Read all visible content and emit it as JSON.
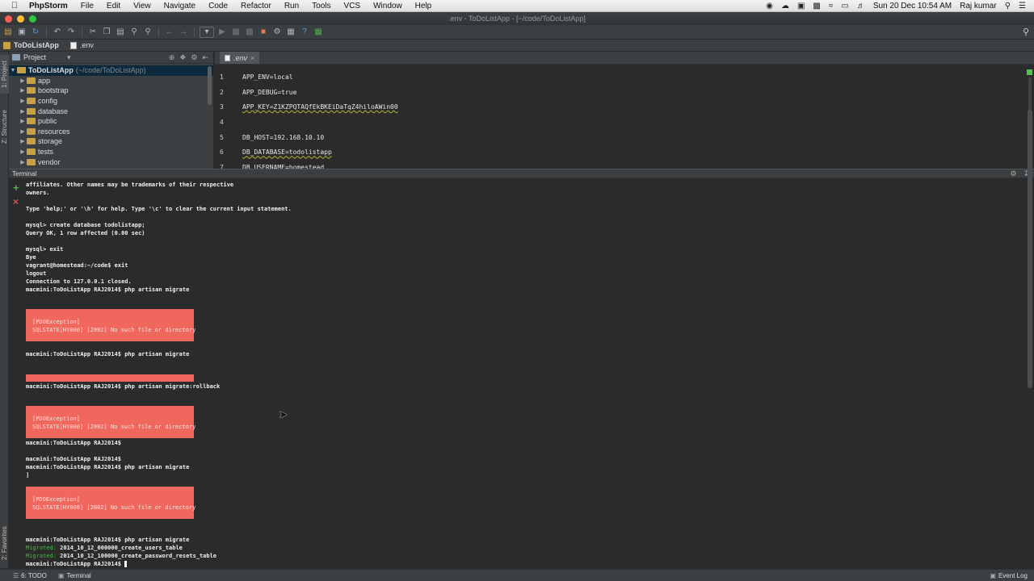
{
  "menubar": {
    "app_name": "PhpStorm",
    "items": [
      "File",
      "Edit",
      "View",
      "Navigate",
      "Code",
      "Refactor",
      "Run",
      "Tools",
      "VCS",
      "Window",
      "Help"
    ],
    "clock": "Sun 20 Dec  10:54 AM",
    "user": "Raj kumar"
  },
  "window": {
    "title": ".env - ToDoListApp - [~/code/ToDoListApp]"
  },
  "navbar": {
    "project": "ToDoListApp",
    "file": ".env"
  },
  "side_tabs": {
    "project": "1: Project",
    "structure": "Z: Structure",
    "favorites": "2: Favorites"
  },
  "project_panel": {
    "label": "Project",
    "root_name": "ToDoListApp",
    "root_path": "(~/code/ToDoListApp)",
    "folders": [
      "app",
      "bootstrap",
      "config",
      "database",
      "public",
      "resources",
      "storage",
      "tests",
      "vendor"
    ]
  },
  "editor": {
    "tab": ".env",
    "lines": [
      {
        "n": "1",
        "text": "APP_ENV=local"
      },
      {
        "n": "2",
        "text": "APP_DEBUG=true"
      },
      {
        "n": "3",
        "text": "APP_KEY=Z1KZPQTAQfEkBKEiDaTqZ4hiloAWin00"
      },
      {
        "n": "4",
        "text": ""
      },
      {
        "n": "5",
        "text": "DB_HOST=192.168.10.10"
      },
      {
        "n": "6",
        "text": "DB_DATABASE=todolistapp"
      },
      {
        "n": "7",
        "text": "DB_USERNAME=homestead"
      }
    ]
  },
  "terminal": {
    "label": "Terminal",
    "lines": {
      "l1": "affiliates. Other names may be trademarks of their respective",
      "l2": "owners.",
      "l3": "Type 'help;' or '\\h' for help. Type '\\c' to clear the current input statement.",
      "l4": "mysql> create database todolistapp;",
      "l5": "Query OK, 1 row affected (0.00 sec)",
      "l6": "mysql> exit",
      "l7": "Bye",
      "l8": "vagrant@homestead:~/code$ exit",
      "l9": "logout",
      "l10": "Connection to 127.0.0.1 closed.",
      "l11": "macmini:ToDoListApp RAJ2014$ php artisan migrate",
      "l12": "macmini:ToDoListApp RAJ2014$ php artisan migrate",
      "l13": "macmini:ToDoListApp RAJ2014$ php artisan migrate:rollback",
      "l14": "macmini:ToDoListApp RAJ2014$",
      "l15": "macmini:ToDoListApp RAJ2014$",
      "l16": "macmini:ToDoListApp RAJ2014$ php artisan migrate",
      "l17": "]",
      "l18": "macmini:ToDoListApp RAJ2014$ php artisan migrate",
      "l19_tag": "Migrated:",
      "l19": " 2014_10_12_000000_create_users_table",
      "l20_tag": "Migrated:",
      "l20": " 2014_10_12_100000_create_password_resets_table",
      "l21": "macmini:ToDoListApp RAJ2014$ "
    },
    "error": {
      "exception": "[PDOException]",
      "message": "SQLSTATE[HY000] [2002] No such file or directory"
    }
  },
  "statusbar": {
    "todo": "6: TODO",
    "terminal": "Terminal",
    "event_log": "Event Log"
  },
  "colors": {
    "error_bg": "#f0675e",
    "migrated_green": "#4eb34e",
    "editor_bg": "#2b2b2b",
    "panel_bg": "#3c3f41"
  }
}
